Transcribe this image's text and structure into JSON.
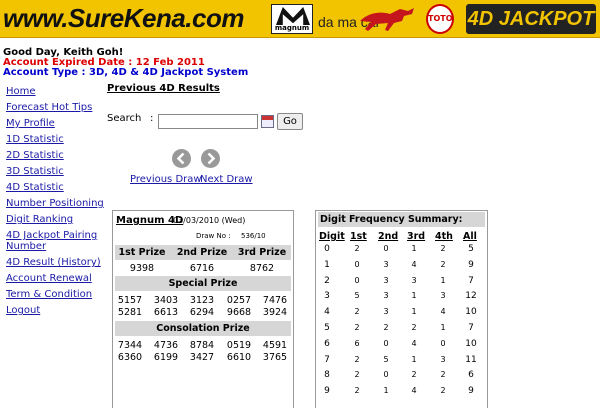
{
  "banner": {
    "site_name": "www.SureKena.com",
    "magnum_text": "magnum",
    "damacai_text": "da ma cai",
    "toto_text": "TOTO",
    "jackpot_text": "4D JACKPOT"
  },
  "account": {
    "greeting": "Good Day, Keith Goh!",
    "expiry": "Account Expired Date : 12 Feb 2011",
    "type": "Account Type : 3D, 4D & 4D Jackpot System"
  },
  "sidebar": {
    "items": [
      {
        "label": "Home"
      },
      {
        "label": "Forecast Hot Tips"
      },
      {
        "label": "My Profile"
      },
      {
        "label": "1D Statistic"
      },
      {
        "label": "2D Statistic"
      },
      {
        "label": "3D Statistic"
      },
      {
        "label": "4D Statistic"
      },
      {
        "label": "Number Positioning"
      },
      {
        "label": "Digit Ranking"
      },
      {
        "label": "4D Jackpot Pairing Number"
      },
      {
        "label": "4D Result (History)"
      },
      {
        "label": "Account Renewal"
      },
      {
        "label": "Term & Condition"
      },
      {
        "label": "Logout"
      }
    ]
  },
  "main": {
    "title": "Previous 4D Results",
    "search": {
      "label": "Search",
      "colon": ":",
      "value": "",
      "button": "Go"
    },
    "nav": {
      "prev": "Previous Draw",
      "next": "Next Draw"
    }
  },
  "result": {
    "operator": "Magnum 4D",
    "date": "03/03/2010 (Wed)",
    "draw_no_label": "Draw No :",
    "draw_no": "536/10",
    "prize_labels": [
      "1st Prize",
      "2nd Prize",
      "3rd Prize"
    ],
    "top_prizes": [
      "9398",
      "6716",
      "8762"
    ],
    "special_label": "Special Prize",
    "special": [
      "5157",
      "3403",
      "3123",
      "0257",
      "7476",
      "5281",
      "6613",
      "6294",
      "9668",
      "3924"
    ],
    "consolation_label": "Consolation Prize",
    "consolation": [
      "7344",
      "4736",
      "8784",
      "0519",
      "4591",
      "6360",
      "6199",
      "3427",
      "6610",
      "3765"
    ]
  },
  "frequency": {
    "title": "Digit Frequency Summary:",
    "headers": [
      "Digit",
      "1st",
      "2nd",
      "3rd",
      "4th",
      "All"
    ],
    "rows": [
      [
        "0",
        "2",
        "0",
        "1",
        "2",
        "5"
      ],
      [
        "1",
        "0",
        "3",
        "4",
        "2",
        "9"
      ],
      [
        "2",
        "0",
        "3",
        "3",
        "1",
        "7"
      ],
      [
        "3",
        "5",
        "3",
        "1",
        "3",
        "12"
      ],
      [
        "4",
        "2",
        "3",
        "1",
        "4",
        "10"
      ],
      [
        "5",
        "2",
        "2",
        "2",
        "1",
        "7"
      ],
      [
        "6",
        "6",
        "0",
        "4",
        "0",
        "10"
      ],
      [
        "7",
        "2",
        "5",
        "1",
        "3",
        "11"
      ],
      [
        "8",
        "2",
        "0",
        "2",
        "2",
        "6"
      ],
      [
        "9",
        "2",
        "1",
        "4",
        "2",
        "9"
      ]
    ]
  },
  "colors": {
    "banner": "#f2c400",
    "link": "#1a1aa6",
    "expiry": "#dd0000",
    "account_type": "#0000cc",
    "header_bg": "#d6d6d6"
  }
}
